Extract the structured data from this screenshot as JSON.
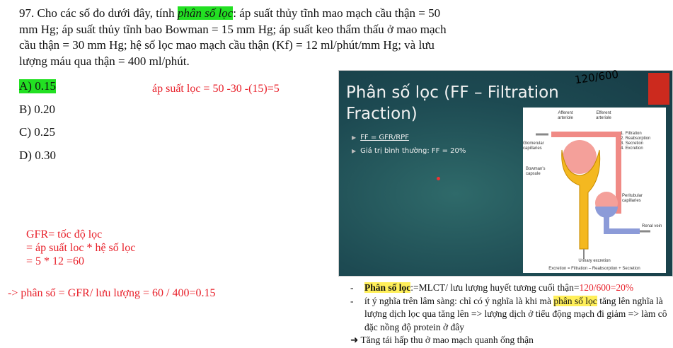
{
  "question": {
    "prefix": "97. Cho các số đo dưới đây, tính ",
    "highlight": "phân số lọc",
    "suffix": ": áp suất thủy tĩnh mao mạch cầu thận = 50 mm Hg; áp suất thủy tĩnh bao Bowman = 15 mm Hg; áp suất keo thẩm thấu ở mao mạch cầu thận = 30 mm Hg; hệ số lọc mao mạch cầu thận (Kf) = 12 ml/phút/mm Hg; và lưu lượng máu qua thận = 400 ml/phút."
  },
  "options": [
    "A) 0.15",
    "B) 0.20",
    "C) 0.25",
    "D) 0.30"
  ],
  "correct_option_color": "#22e022",
  "annotations": {
    "filtration_pressure": "áp suất lọc = 50 -30 -(15)=5",
    "gfr_lines": [
      "GFR= tốc độ lọc",
      "= áp suất loc  *  hệ số lọc",
      "= 5 * 12 =60"
    ],
    "result": "-> phân số = GFR/ lưu lượng = 60 / 400=0.15",
    "color": "#e8202a"
  },
  "slide": {
    "title": "Phân số lọc (FF – Filtration Fraction)",
    "bullets": [
      "FF = GFR/RPF",
      "Giá trị bình thường: FF = 20%"
    ],
    "handwriting": "120/600",
    "diagram": {
      "afferent": "Afferent arteriole",
      "efferent": "Efferent arteriole",
      "glomerular": "Glomerular capillaries",
      "bowman": "Bowman's capsule",
      "peritubular": "Peritubular capillaries",
      "renal_vein": "Renal vein",
      "steps": [
        "1. Filtration",
        "2. Reabsorption",
        "3. Secretion",
        "4. Excretion"
      ],
      "urinary": "Urinary excretion",
      "equation": "Excretion = Filtration – Reabsorption + Secretion"
    }
  },
  "notes": {
    "line1_bold": "Phân số lọc",
    "line1_text": ":=MLCT/ lưu lượng huyết tương cuối thận=",
    "line1_red": "120/600=20%",
    "line2_pre": " ít ý nghĩa trên lâm sàng:  chỉ có ý nghĩa là khi mà ",
    "line2_hl": "phân số lọc",
    "line2_post": " tăng lên nghĩa là lượng dịch lọc qua tăng lên => lượng dịch ở tiểu động mạch đi giảm => làm cô đặc nồng độ protein ở đây",
    "line3": "Tăng tái hấp thu ở mao mạch quanh ống thận"
  }
}
